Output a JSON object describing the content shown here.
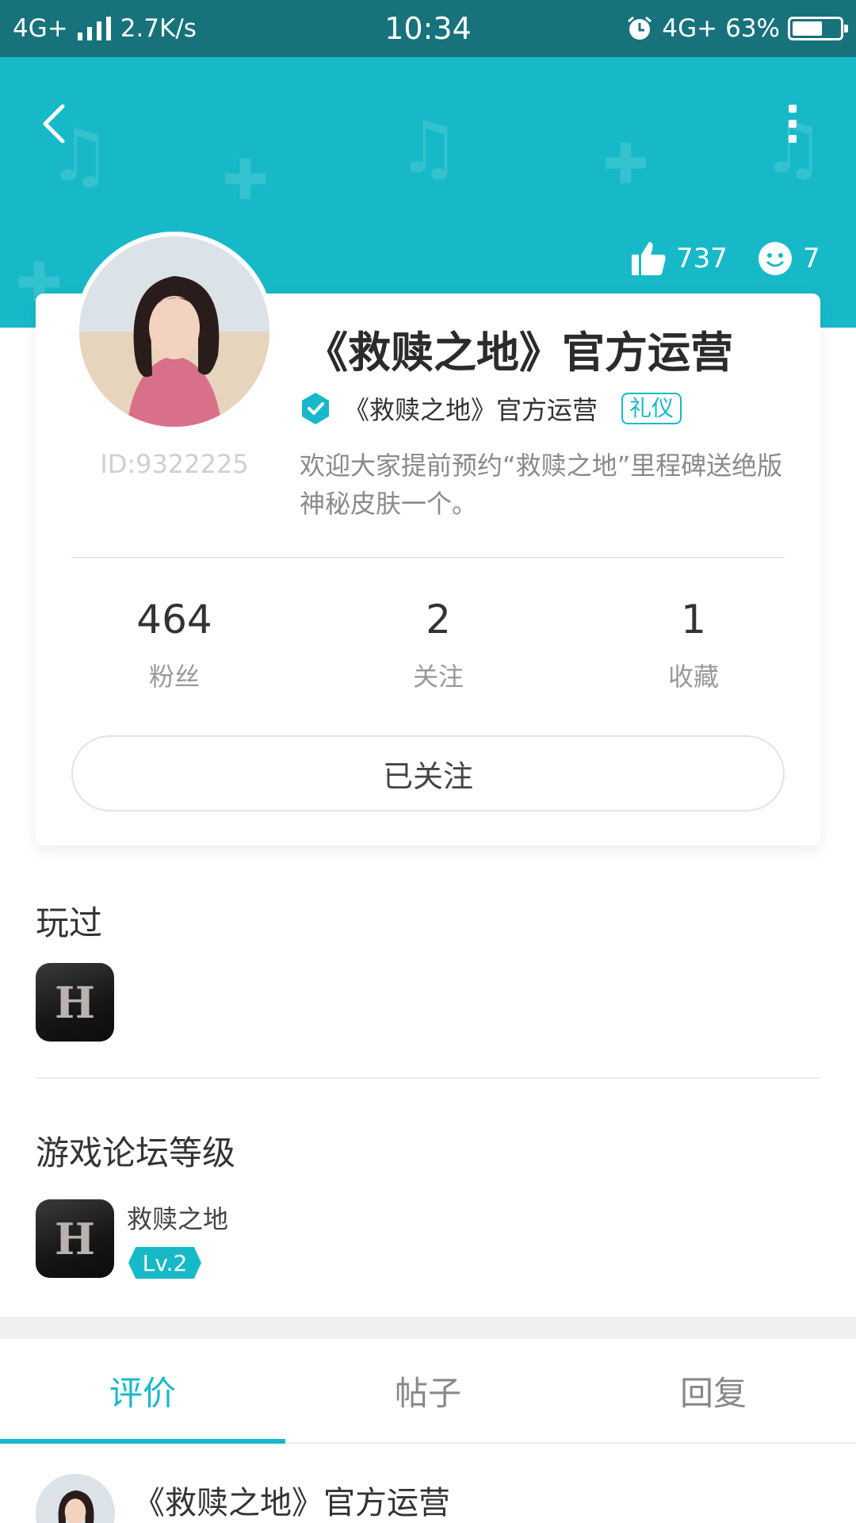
{
  "status_bar": {
    "network": "4G+",
    "speed": "2.7K/s",
    "time": "10:34",
    "network_right": "4G+",
    "battery": "63%",
    "battery_level": 0.63
  },
  "header": {
    "likes": "737",
    "smiles": "7"
  },
  "profile": {
    "name": "《救赎之地》官方运营",
    "verified_name": "《救赎之地》官方运营",
    "tag": "礼仪",
    "id": "ID:9322225",
    "bio": "欢迎大家提前预约“救赎之地”里程碑送绝版神秘皮肤一个。",
    "stats": [
      {
        "value": "464",
        "label": "粉丝"
      },
      {
        "value": "2",
        "label": "关注"
      },
      {
        "value": "1",
        "label": "收藏"
      }
    ],
    "follow_label": "已关注"
  },
  "played": {
    "title": "玩过",
    "icon_letter": "H"
  },
  "forum_level": {
    "title": "游戏论坛等级",
    "icon_letter": "H",
    "game_name": "救赎之地",
    "level": "Lv.2"
  },
  "tabs": [
    {
      "label": "评价",
      "active": true
    },
    {
      "label": "帖子",
      "active": false
    },
    {
      "label": "回复",
      "active": false
    }
  ],
  "post_preview": {
    "title": "《救赎之地》官方运营"
  },
  "colors": {
    "accent": "#17b9c8",
    "status_bar": "#17727c"
  }
}
